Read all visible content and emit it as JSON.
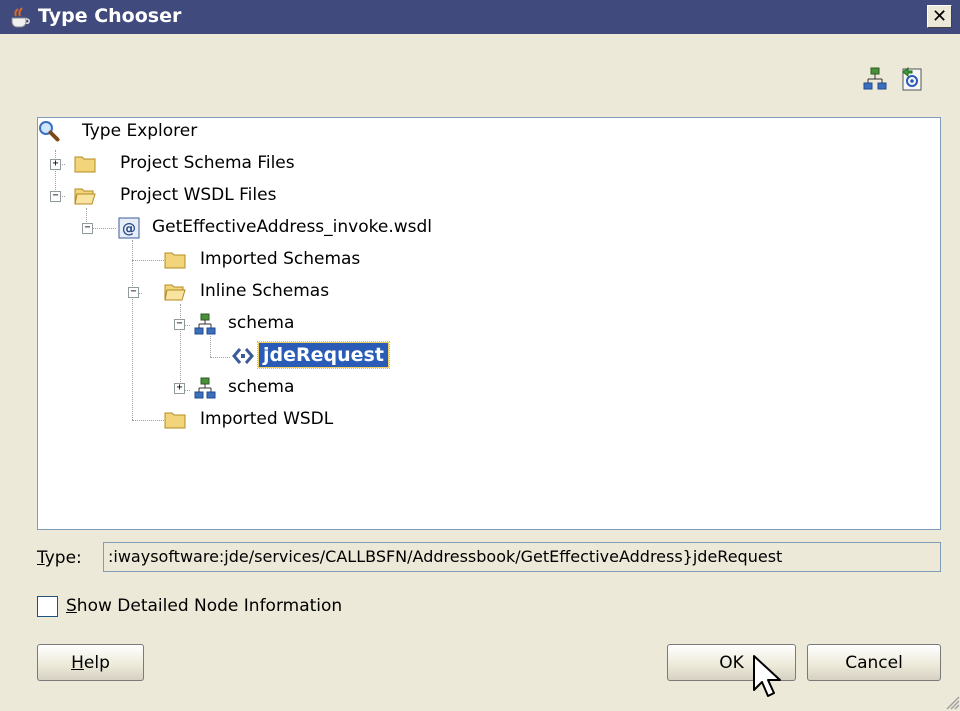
{
  "window": {
    "title": "Type Chooser",
    "icon": "java-cup-icon",
    "close_label": "✕"
  },
  "toolbar": {
    "buttons": [
      {
        "icon": "schema-tree-icon"
      },
      {
        "icon": "import-icon"
      }
    ]
  },
  "tree": {
    "root_label": "Type Explorer",
    "nodes": {
      "project_schema_files": "Project Schema Files",
      "project_wsdl_files": "Project WSDL Files",
      "wsdl_file": "GetEffectiveAddress_invoke.wsdl",
      "imported_schemas": "Imported Schemas",
      "inline_schemas": "Inline Schemas",
      "schema1": "schema",
      "jde_request": "jdeRequest",
      "schema2": "schema",
      "imported_wsdl": "Imported WSDL"
    },
    "expander_expanded": "−",
    "expander_collapsed": "+"
  },
  "type_field": {
    "label_mnemonic": "T",
    "label_rest": "ype:",
    "value": ":iwaysoftware:jde/services/CALLBSFN/Addressbook/GetEffectiveAddress}jdeRequest"
  },
  "detail_checkbox": {
    "label_mnemonic": "S",
    "label_rest": "how Detailed Node Information",
    "checked": false
  },
  "buttons": {
    "help_mnemonic": "H",
    "help_rest": "elp",
    "ok": "OK",
    "cancel": "Cancel"
  },
  "colors": {
    "titlebar": "#404a7c",
    "dialog_bg": "#ece9d8",
    "selection": "#2a5bb6",
    "folder": "#f2d57a"
  }
}
